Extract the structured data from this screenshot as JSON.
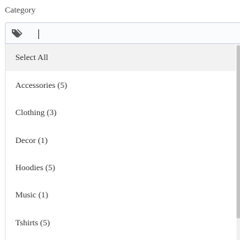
{
  "field": {
    "label": "Category"
  },
  "input": {
    "value": "",
    "icon": "tags-icon"
  },
  "options": [
    {
      "label": "Select All"
    },
    {
      "label": "Accessories (5)"
    },
    {
      "label": "Clothing (3)"
    },
    {
      "label": "Decor (1)"
    },
    {
      "label": "Hoodies (5)"
    },
    {
      "label": "Music (1)"
    },
    {
      "label": "Tshirts (5)"
    }
  ],
  "colors": {
    "highlight": "#f2f2f2",
    "border": "#cfd3e0",
    "scroll_thumb": "#c4c4c4"
  }
}
